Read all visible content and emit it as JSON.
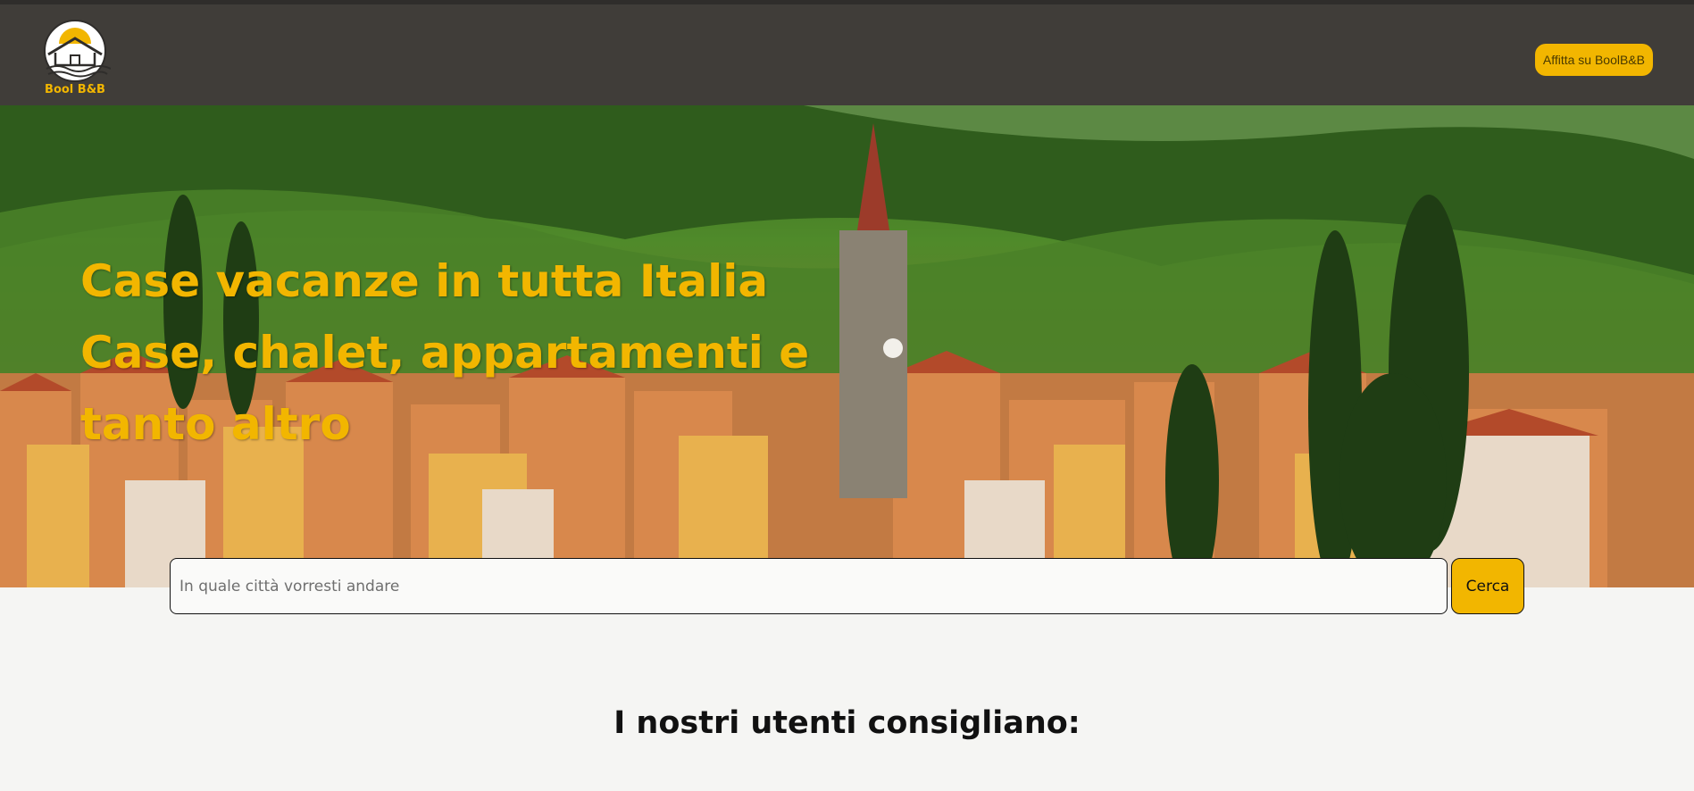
{
  "header": {
    "logo_text": "Bool B&B",
    "rent_button": "Affitta su BoolB&B"
  },
  "hero": {
    "line1": "Case vacanze in tutta Italia",
    "line2": "Case, chalet, appartamenti e tanto altro"
  },
  "search": {
    "placeholder": "In quale città vorresti andare",
    "value": "",
    "button_label": "Cerca"
  },
  "recommendations": {
    "title": "I nostri utenti consigliano:"
  },
  "colors": {
    "header_bg": "#403d39",
    "accent": "#f2b600",
    "page_bg": "#f5f5f3"
  },
  "icons": {
    "logo": "house-on-waves-logo-icon"
  }
}
